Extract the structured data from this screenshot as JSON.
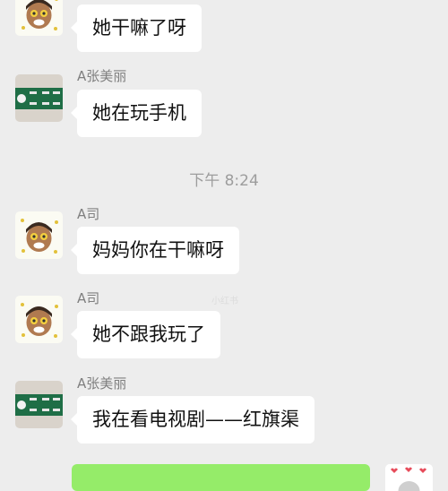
{
  "chat": {
    "time_divider": "下午 8:24",
    "watermark": "小红书",
    "messages": [
      {
        "sender": "",
        "text": "她干嘛了呀",
        "avatar": "cartoon-face-icon"
      },
      {
        "sender": "A张美丽",
        "text": "她在玩手机",
        "avatar": "green-banner-icon"
      },
      {
        "sender": "A司",
        "text": "妈妈你在干嘛呀",
        "avatar": "cartoon-face-icon"
      },
      {
        "sender": "A司",
        "text": "她不跟我玩了",
        "avatar": "cartoon-face-icon"
      },
      {
        "sender": "A张美丽",
        "text": "我在看电视剧——红旗渠",
        "avatar": "green-banner-icon"
      }
    ]
  },
  "colors": {
    "background": "#ededed",
    "bubble_incoming": "#ffffff",
    "bubble_outgoing": "#95ec69",
    "sender_text": "#7f7f7f",
    "timestamp_text": "#9d9d9d"
  }
}
